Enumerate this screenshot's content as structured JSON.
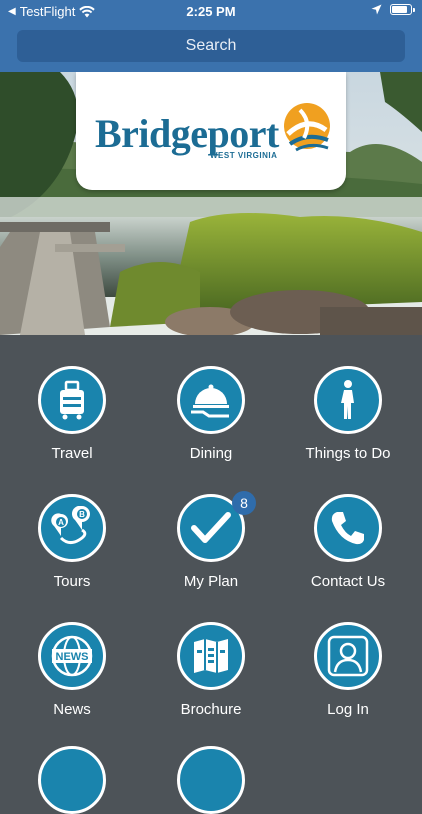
{
  "status_bar": {
    "back_app": "TestFlight",
    "time": "2:25 PM",
    "battery_level": 0.85
  },
  "header": {
    "search_label": "Search"
  },
  "hero": {
    "logo_name": "Bridgeport",
    "logo_sub": "WEST VIRGINIA"
  },
  "menu": {
    "items": [
      {
        "label": "Travel",
        "icon": "luggage-icon"
      },
      {
        "label": "Dining",
        "icon": "serving-cloche-icon"
      },
      {
        "label": "Things to Do",
        "icon": "walking-person-icon"
      },
      {
        "label": "Tours",
        "icon": "route-map-icon"
      },
      {
        "label": "My Plan",
        "icon": "checkmark-icon",
        "badge": "8"
      },
      {
        "label": "Contact Us",
        "icon": "phone-icon"
      },
      {
        "label": "News",
        "icon": "news-globe-icon"
      },
      {
        "label": "Brochure",
        "icon": "brochure-map-icon"
      },
      {
        "label": "Log In",
        "icon": "user-icon"
      }
    ]
  },
  "colors": {
    "header_blue": "#3b72ad",
    "icon_blue": "#1a84ad",
    "background": "#4d5358"
  }
}
